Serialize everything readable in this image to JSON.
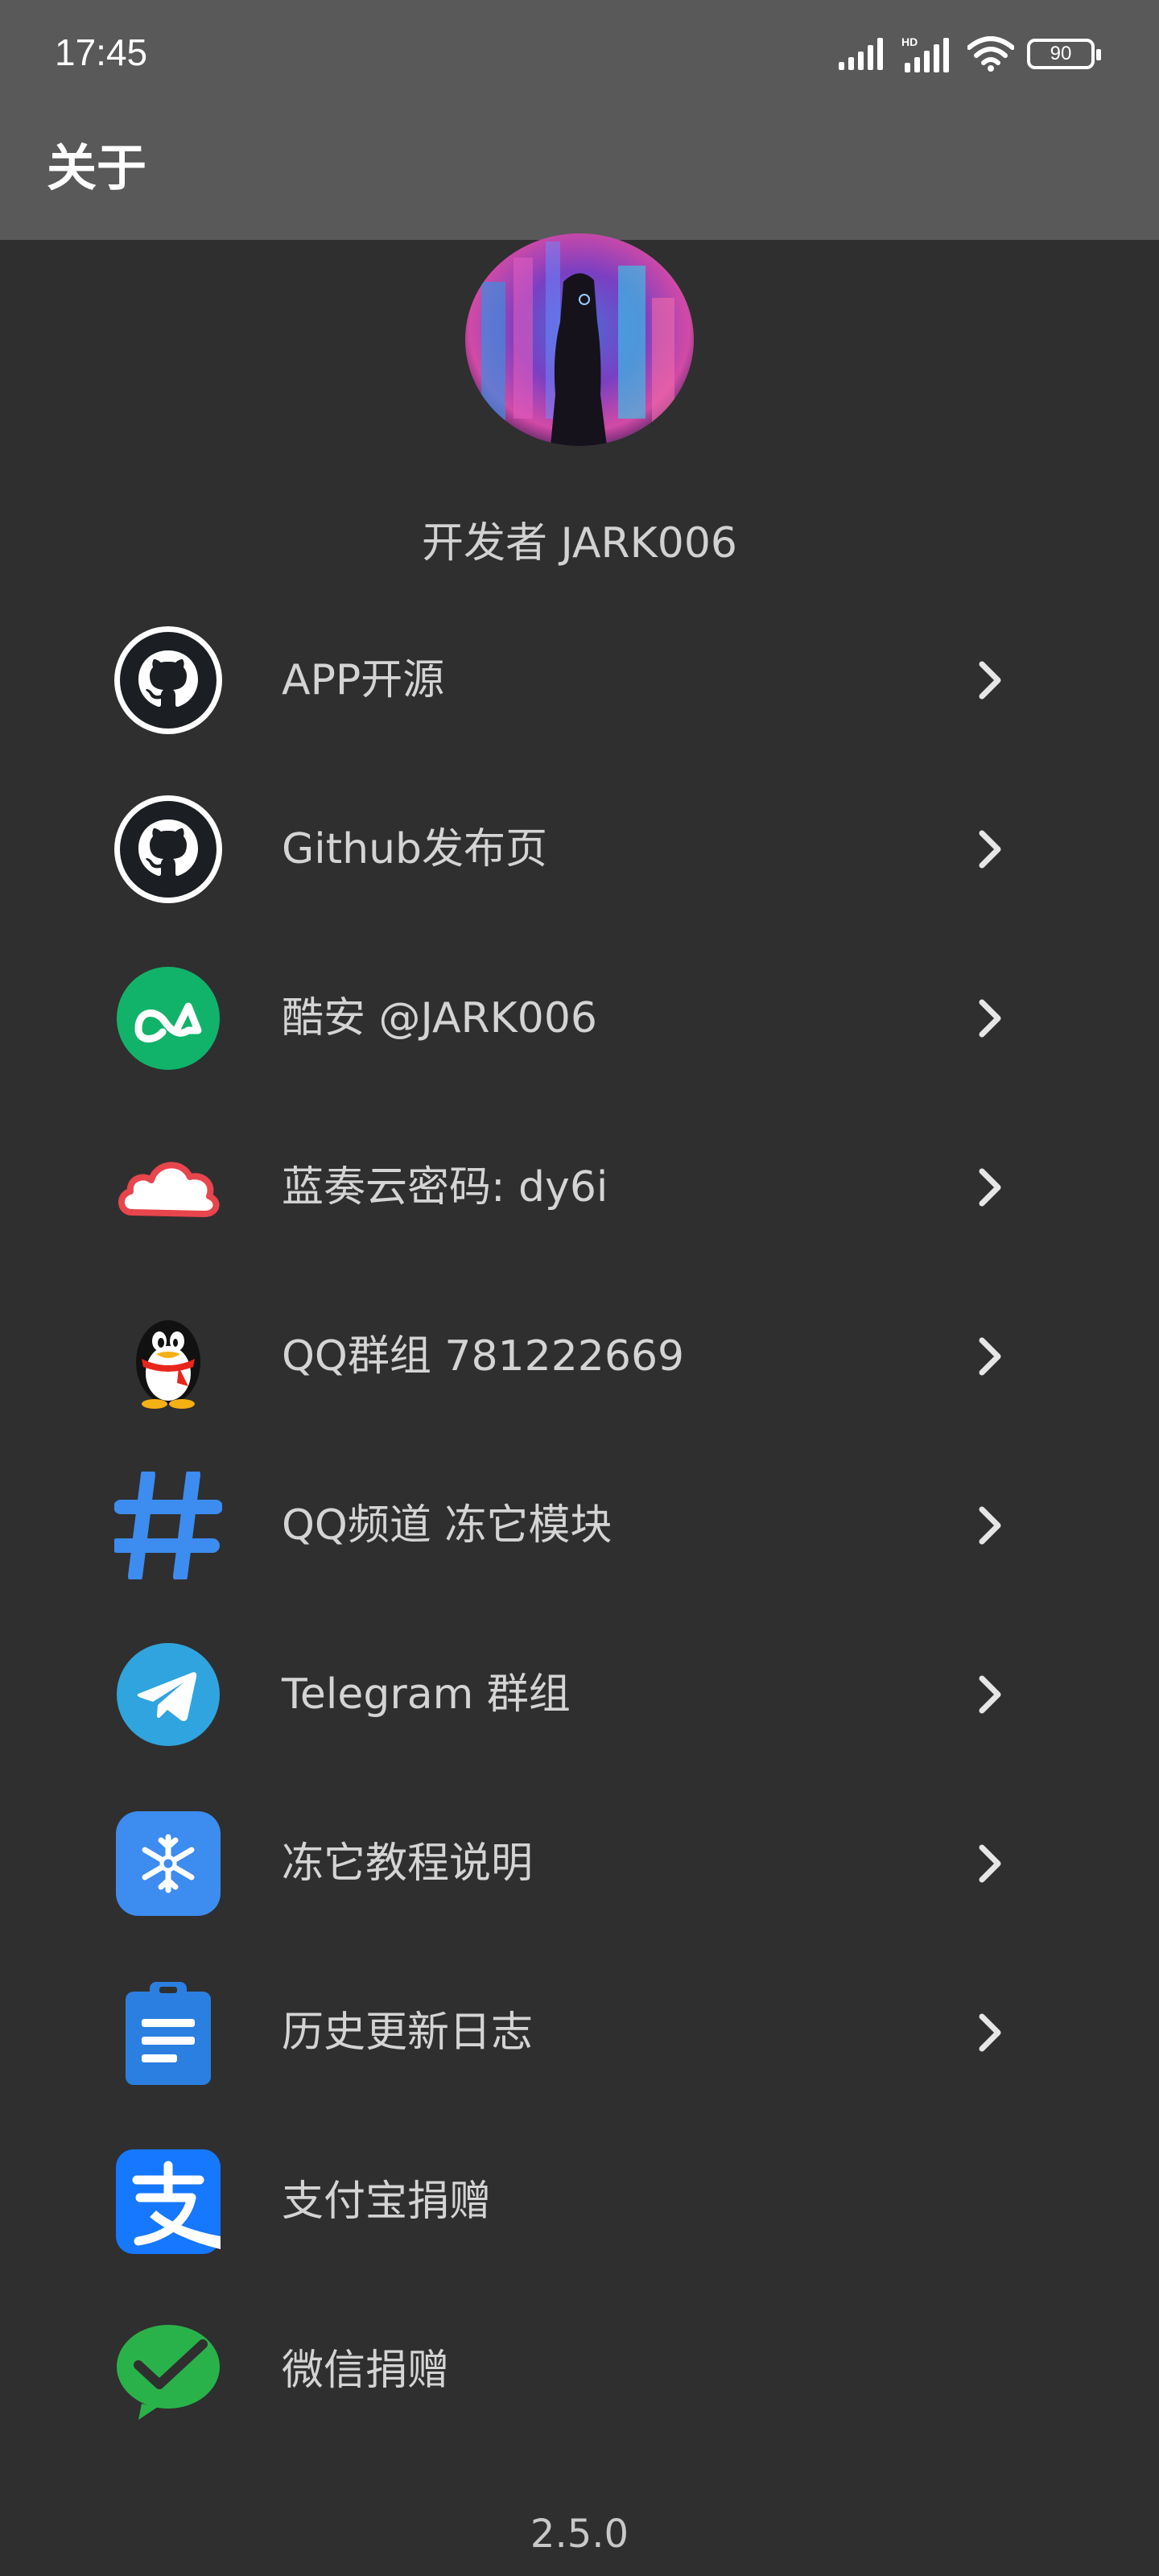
{
  "status_bar": {
    "time": "17:45",
    "battery": "90",
    "icons": [
      "signal-icon",
      "hd-signal-icon",
      "wifi-icon",
      "battery-icon"
    ]
  },
  "header": {
    "title": "关于"
  },
  "profile": {
    "developer": "开发者 JARK006"
  },
  "menu": {
    "items": [
      {
        "label": "APP开源",
        "icon": "github-icon",
        "has_chevron": true
      },
      {
        "label": "Github发布页",
        "icon": "github-icon",
        "has_chevron": true
      },
      {
        "label": "酷安 @JARK006",
        "icon": "coolapk-icon",
        "has_chevron": true
      },
      {
        "label": "蓝奏云密码: dy6i",
        "icon": "lanzou-cloud-icon",
        "has_chevron": true
      },
      {
        "label": "QQ群组 781222669",
        "icon": "qq-penguin-icon",
        "has_chevron": true
      },
      {
        "label": "QQ频道 冻它模块",
        "icon": "qq-channel-icon",
        "has_chevron": true
      },
      {
        "label": "Telegram 群组",
        "icon": "telegram-icon",
        "has_chevron": true
      },
      {
        "label": "冻它教程说明",
        "icon": "snowflake-icon",
        "has_chevron": true
      },
      {
        "label": "历史更新日志",
        "icon": "clipboard-icon",
        "has_chevron": true
      },
      {
        "label": "支付宝捐赠",
        "icon": "alipay-icon",
        "has_chevron": false
      },
      {
        "label": "微信捐赠",
        "icon": "wechat-pay-icon",
        "has_chevron": false
      }
    ]
  },
  "version": "2.5.0",
  "colors": {
    "background": "#2f2f2f",
    "header": "#595959",
    "text": "#d4d4d4",
    "coolapk": "#11b36a",
    "qq_channel": "#3d8cf0",
    "telegram": "#30a4de",
    "tutorial": "#3d8cf0",
    "changelog": "#2b7fe0",
    "alipay": "#1677ff",
    "wechat": "#2ab24a"
  }
}
